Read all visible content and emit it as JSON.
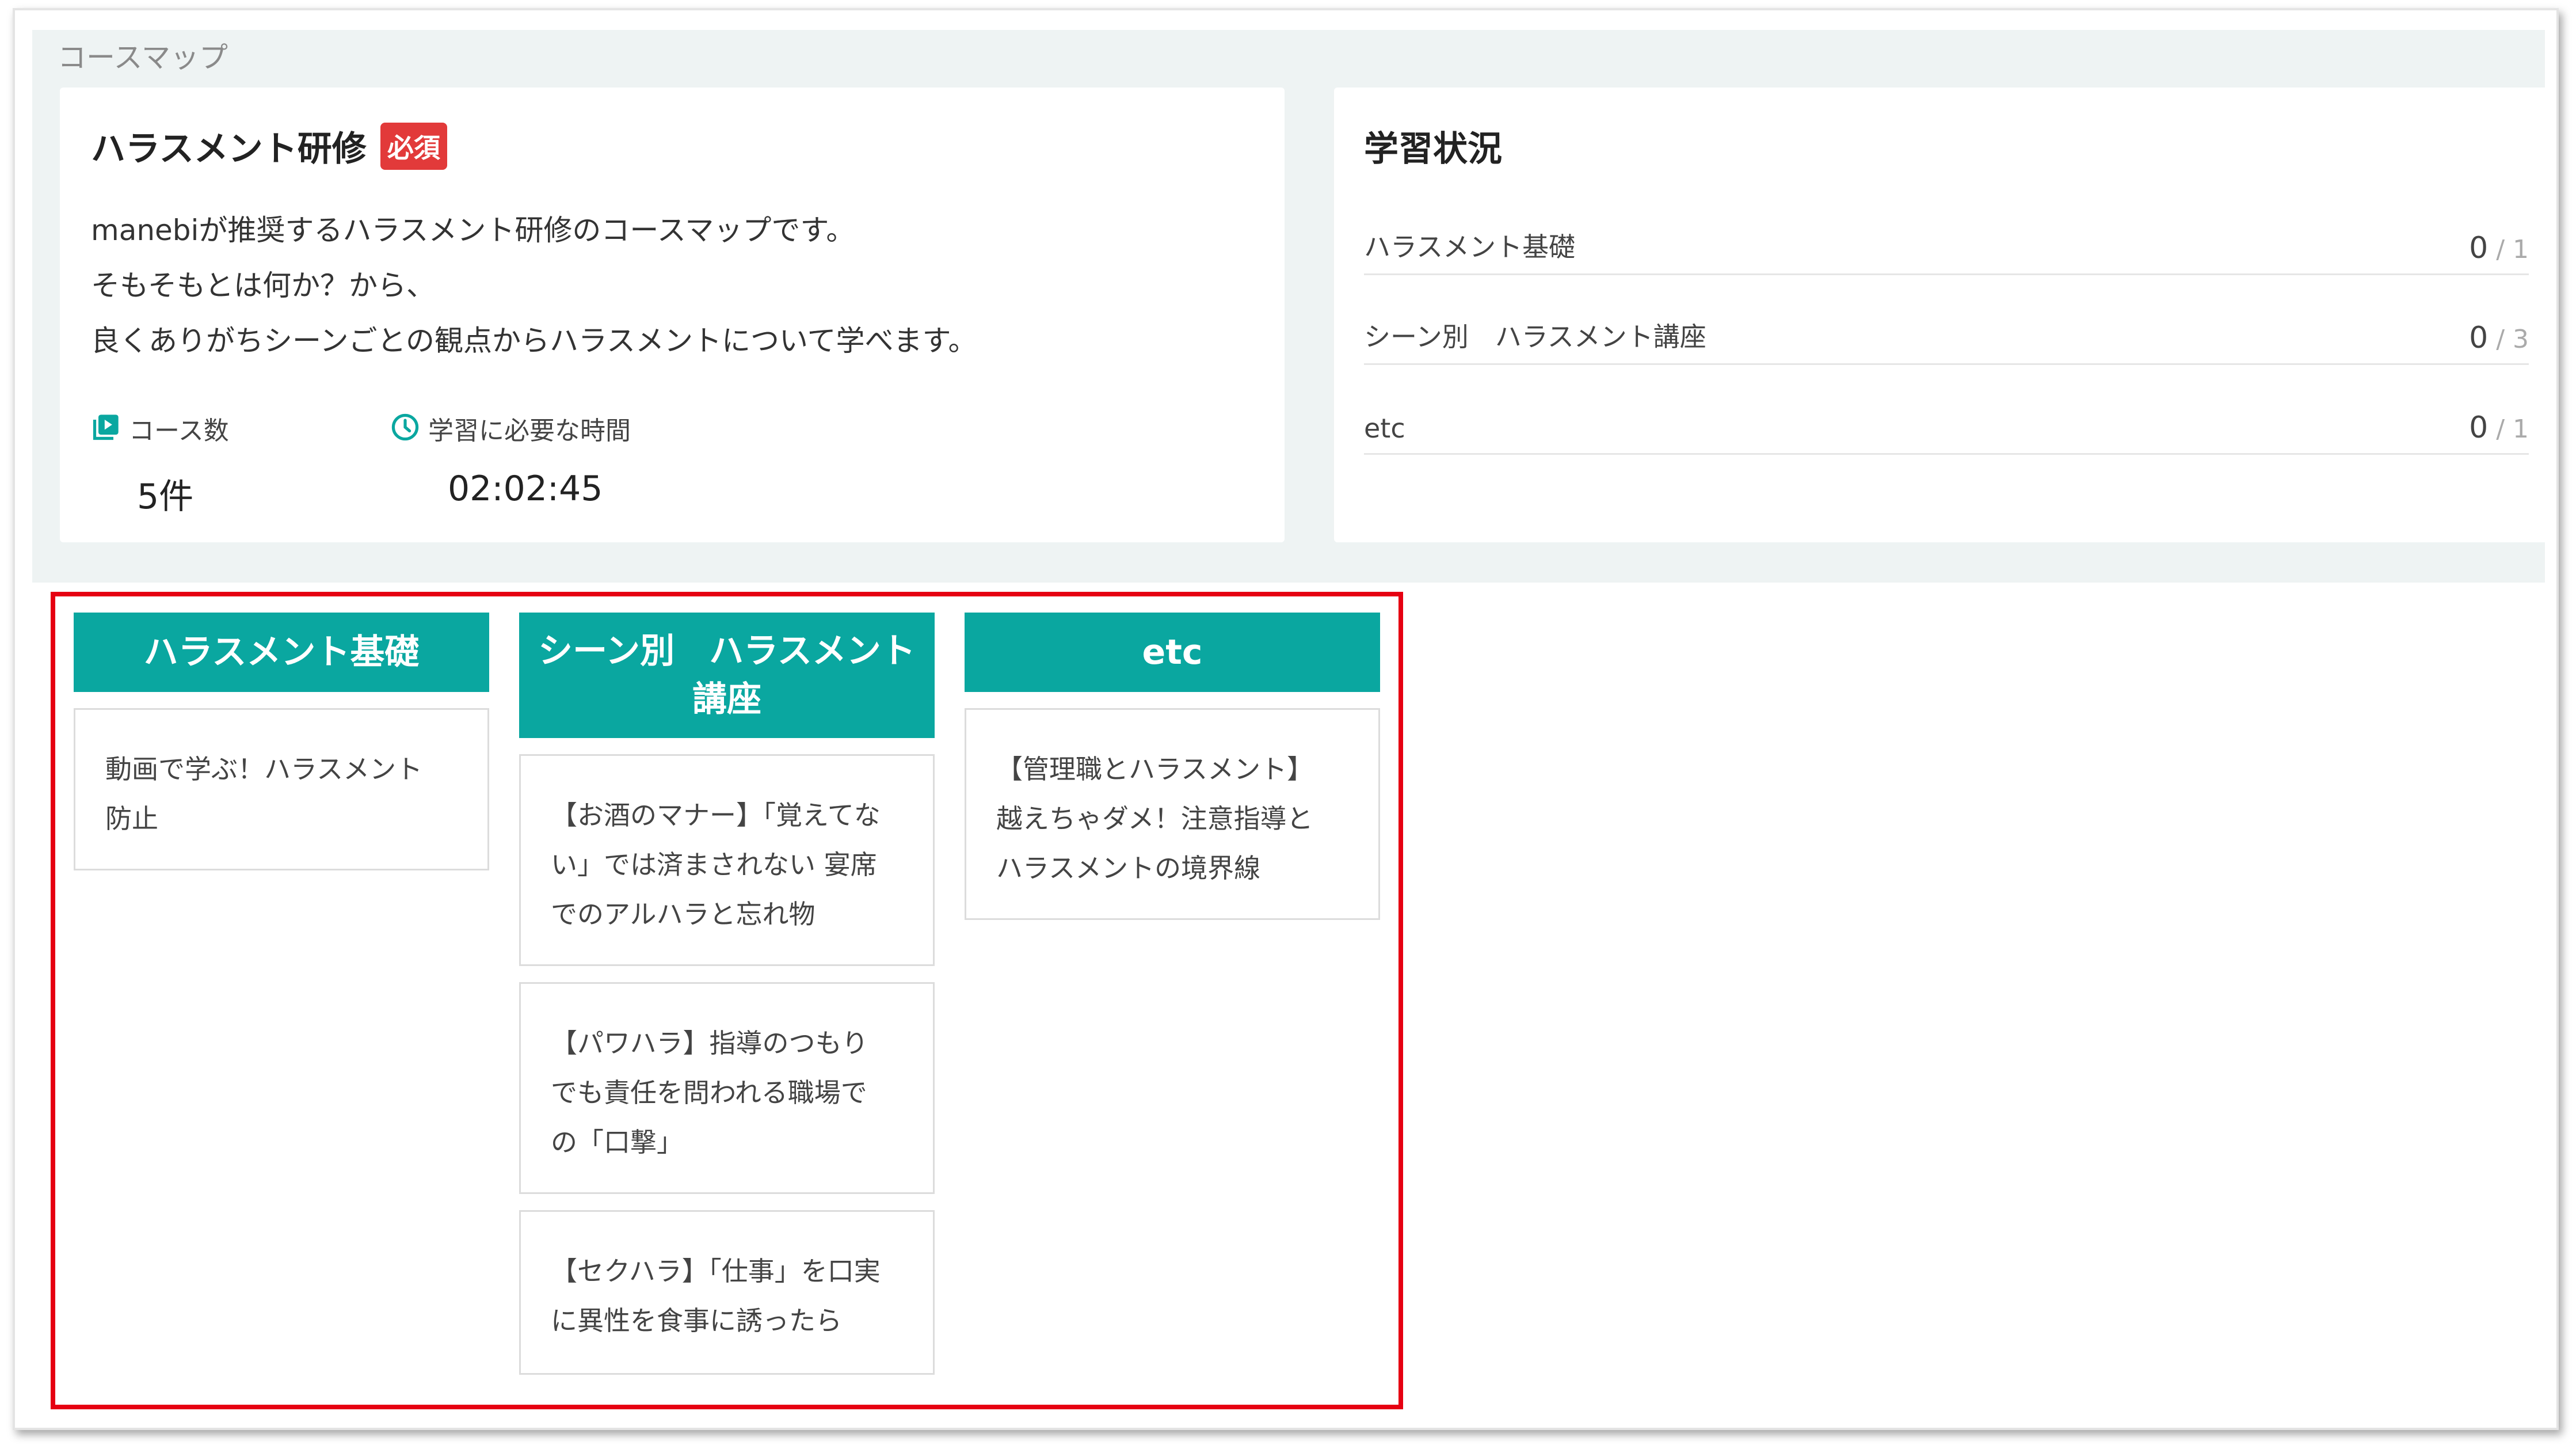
{
  "section_title": "コースマップ",
  "course": {
    "title": "ハラスメント研修",
    "badge": "必須",
    "description": [
      "manebiが推奨するハラスメント研修のコースマップです。",
      "そもそもとは何か？から、",
      "良くありがちシーンごとの観点からハラスメントについて学べます。"
    ],
    "count_label": "コース数",
    "count_value": "5件",
    "time_label": "学習に必要な時間",
    "time_value": "02:02:45",
    "icons": {
      "count": "video-library-icon",
      "time": "clock-icon"
    },
    "accent_color": "#0aa7a0",
    "badge_color": "#e23a3a"
  },
  "status": {
    "title": "学習状況",
    "rows": [
      {
        "label": "ハラスメント基礎",
        "done": "0",
        "total": "1"
      },
      {
        "label": "シーン別　ハラスメント講座",
        "done": "0",
        "total": "3"
      },
      {
        "label": "etc",
        "done": "0",
        "total": "1"
      }
    ]
  },
  "map": {
    "highlight_color": "#e60012",
    "columns": [
      {
        "header": "ハラスメント基礎",
        "courses": [
          "動画で学ぶ！ハラスメント\n防止"
        ]
      },
      {
        "header": "シーン別　ハラスメント\n講座",
        "courses": [
          "【お酒のマナー】「覚えてな\nい」では済まされない 宴席\nでのアルハラと忘れ物",
          "【パワハラ】指導のつもり\nでも責任を問われる職場で\nの「口撃」",
          "【セクハラ】「仕事」を口実\nに異性を食事に誘ったら"
        ]
      },
      {
        "header": "etc",
        "courses": [
          "【管理職とハラスメント】\n越えちゃダメ！注意指導と\nハラスメントの境界線"
        ]
      }
    ]
  }
}
